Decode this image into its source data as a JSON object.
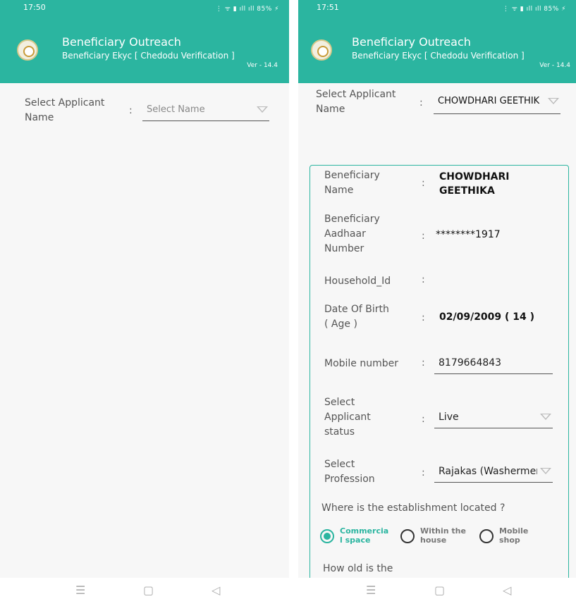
{
  "left": {
    "status": {
      "time": "17:50",
      "icons": "⋮ ᯤ ▮ ıll ıll 85% ⚡"
    },
    "appbar": {
      "title": "Beneficiary Outreach",
      "subtitle": "Beneficiary Ekyc [ Chedodu Verification ]",
      "version": "Ver - 14.4"
    },
    "applicant": {
      "label_line1": "Select Applicant",
      "label_line2": "Name",
      "colon": ":",
      "placeholder": "Select Name"
    }
  },
  "right": {
    "status": {
      "time": "17:51",
      "icons": "⋮ ᯤ ▮ ıll ıll 85% ⚡"
    },
    "appbar": {
      "title": "Beneficiary Outreach",
      "subtitle": "Beneficiary Ekyc [ Chedodu Verification ]",
      "version": "Ver - 14.4"
    },
    "applicant": {
      "label_line1": "Select Applicant",
      "label_line2": "Name",
      "colon": ":",
      "value": "CHOWDHARI GEETHIK"
    },
    "card": {
      "name": {
        "label_line1": "Beneficiary",
        "label_line2": "Name",
        "value_line1": "CHOWDHARI",
        "value_line2": "GEETHIKA"
      },
      "aadhaar": {
        "label_line1": "Beneficiary",
        "label_line2": "Aadhaar",
        "label_line3": "Number",
        "value": "********1917"
      },
      "household": {
        "label": "Household_Id",
        "value": ""
      },
      "dob": {
        "label_line1": "Date Of Birth",
        "label_line2": "( Age )",
        "value": "02/09/2009 ( 14 )"
      },
      "mobile": {
        "label": "Mobile number",
        "value": "8179664843"
      },
      "status": {
        "label_line1": "Select",
        "label_line2": "Applicant",
        "label_line3": "status",
        "value": "Live"
      },
      "profession": {
        "label_line1": "Select",
        "label_line2": "Profession",
        "value": "Rajakas (Washermen)"
      },
      "establishment": {
        "question": "Where is the establishment located ?",
        "options": [
          {
            "line1": "Commercia",
            "line2": "l space",
            "selected": true
          },
          {
            "line1": "Within the",
            "line2": "house",
            "selected": false
          },
          {
            "line1": "Mobile",
            "line2": "shop",
            "selected": false
          }
        ]
      },
      "next_question": "How old is the"
    }
  },
  "navbar": {
    "menu_icon": "☰",
    "home_icon": "▢",
    "back_icon": "◁"
  },
  "colors": {
    "accent": "#2bb5a0"
  }
}
